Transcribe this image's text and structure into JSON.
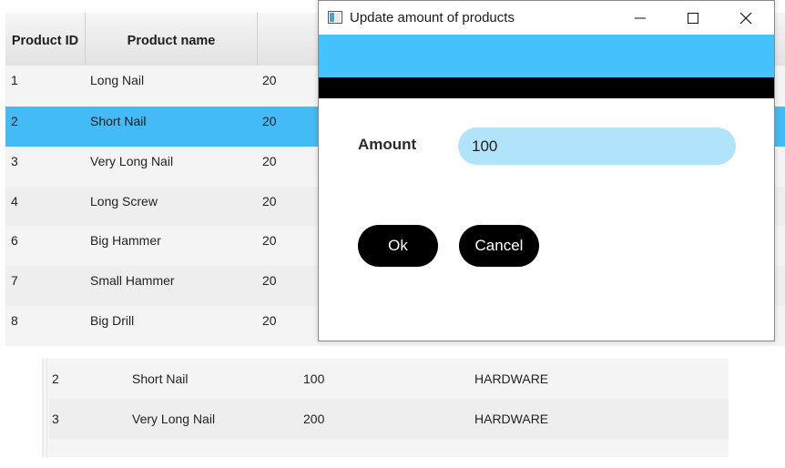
{
  "table": {
    "headers": {
      "product_id": "Product ID",
      "product_name": "Product name"
    },
    "rows": [
      {
        "id": "1",
        "name": "Long Nail",
        "amount": "20"
      },
      {
        "id": "2",
        "name": "Short Nail",
        "amount": "20"
      },
      {
        "id": "3",
        "name": "Very Long Nail",
        "amount": "20"
      },
      {
        "id": "4",
        "name": "Long Screw",
        "amount": "20"
      },
      {
        "id": "6",
        "name": "Big Hammer",
        "amount": "20"
      },
      {
        "id": "7",
        "name": "Small Hammer",
        "amount": "20"
      },
      {
        "id": "8",
        "name": "Big Drill",
        "amount": "20"
      }
    ],
    "selected_row": "2"
  },
  "bottom_table": {
    "rows": [
      {
        "id": "2",
        "name": "Short Nail",
        "amount": "100",
        "category": "HARDWARE"
      },
      {
        "id": "3",
        "name": "Very Long Nail",
        "amount": "200",
        "category": "HARDWARE"
      }
    ]
  },
  "dialog": {
    "title": "Update amount of products",
    "icons": {
      "app": "window-app-icon",
      "minimize": "minimize-icon",
      "maximize": "maximize-icon",
      "close": "close-icon"
    },
    "amount_label": "Amount",
    "amount_value": "100",
    "ok_label": "Ok",
    "cancel_label": "Cancel"
  },
  "colors": {
    "accent_blue": "#43c2fb",
    "selection_blue": "#43bbf7",
    "input_bg": "#b1e4fb",
    "button_bg": "#000000"
  }
}
